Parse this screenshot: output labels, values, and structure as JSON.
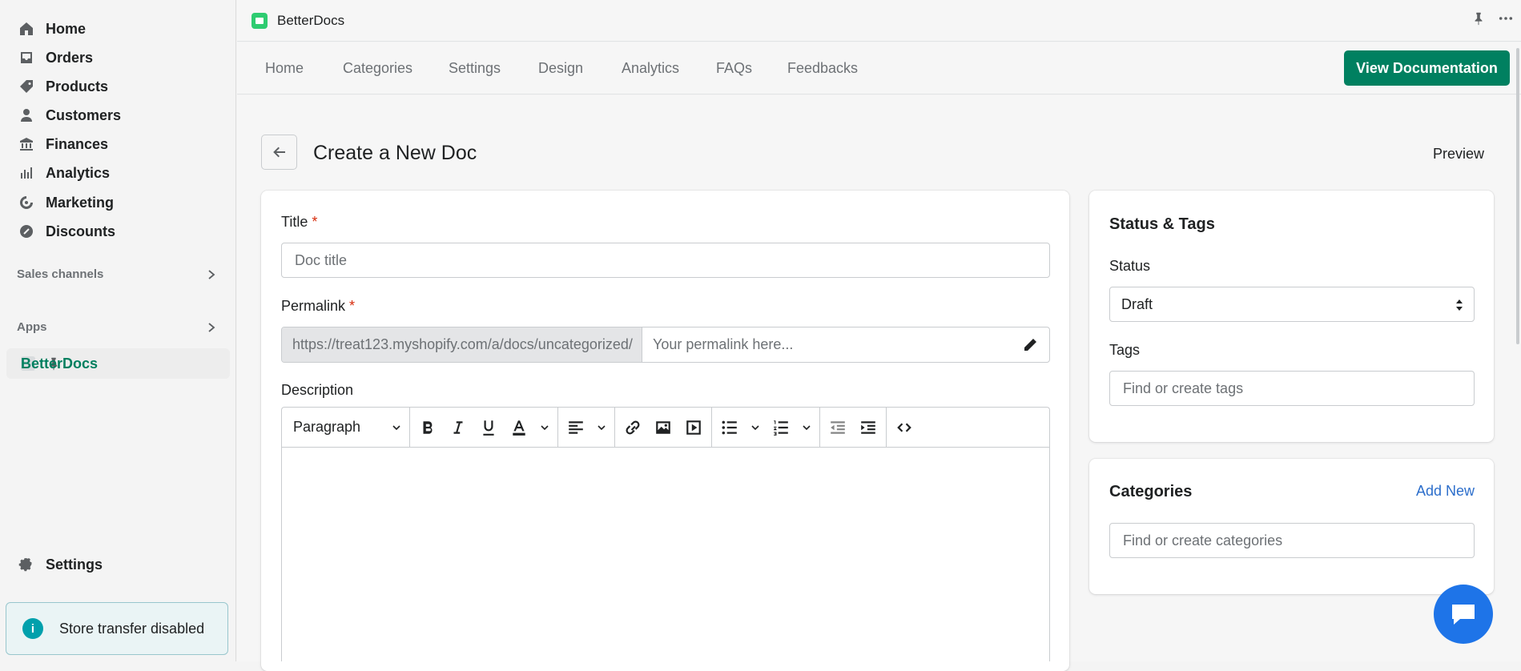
{
  "sidebar": {
    "items": [
      {
        "label": "Home",
        "icon": "home-icon"
      },
      {
        "label": "Orders",
        "icon": "orders-icon"
      },
      {
        "label": "Products",
        "icon": "tag-icon"
      },
      {
        "label": "Customers",
        "icon": "person-icon"
      },
      {
        "label": "Finances",
        "icon": "bank-icon"
      },
      {
        "label": "Analytics",
        "icon": "bar-chart-icon"
      },
      {
        "label": "Marketing",
        "icon": "target-icon"
      },
      {
        "label": "Discounts",
        "icon": "discount-icon"
      }
    ],
    "sales_channels": "Sales channels",
    "apps": "Apps",
    "active_app": "BetterDocs",
    "settings": "Settings",
    "store_banner": "Store transfer disabled"
  },
  "topbar": {
    "app_name": "BetterDocs"
  },
  "appnav": {
    "tabs": [
      "Home",
      "Categories",
      "Settings",
      "Design",
      "Analytics",
      "FAQs",
      "Feedbacks"
    ],
    "view_documentation": "View Documentation"
  },
  "page": {
    "title": "Create a New Doc",
    "preview": "Preview"
  },
  "form": {
    "title_label": "Title",
    "required_mark": "*",
    "title_placeholder": "Doc title",
    "permalink_label": "Permalink",
    "permalink_prefix": "https://treat123.myshopify.com/a/docs/uncategorized/",
    "permalink_placeholder": "Your permalink here...",
    "description_label": "Description",
    "paragraph_select": "Paragraph"
  },
  "status_tags": {
    "title": "Status & Tags",
    "status_label": "Status",
    "status_value": "Draft",
    "tags_label": "Tags",
    "tags_placeholder": "Find or create tags"
  },
  "categories": {
    "title": "Categories",
    "add_new": "Add New",
    "placeholder": "Find or create categories"
  },
  "colors": {
    "primary": "#008060",
    "link": "#2c6ecb",
    "chat": "#1e74e8"
  }
}
